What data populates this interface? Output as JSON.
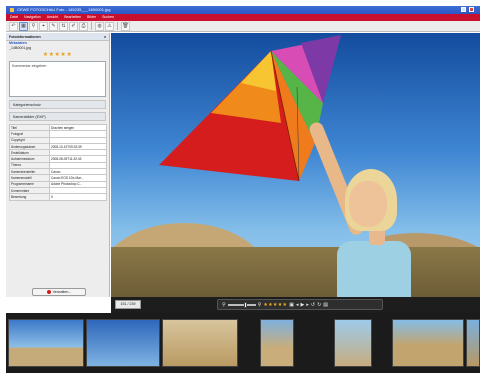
{
  "window": {
    "title": "CEWE FOTOSCHAU Foto - 145235___14B0001.jpg",
    "close_glyph": "×"
  },
  "menu": [
    "Datei",
    "Navigation",
    "Ansicht",
    "Bearbeiten",
    "Bilder",
    "Suchen"
  ],
  "toolbar": {
    "icons": [
      "back-icon",
      "grid-icon",
      "zoom-icon",
      "crop-icon",
      "tools-icon",
      "sort-icon",
      "pen-icon",
      "print-icon",
      "globe-icon",
      "warning-icon",
      "trash-icon"
    ],
    "glyphs": [
      "↶",
      "▦",
      "⚲",
      "⌖",
      "✎",
      "⇅",
      "✐",
      "⎙",
      "◍",
      "⚠",
      "🗑"
    ],
    "active_index": 1
  },
  "sidebar": {
    "header": "Fotoinformationen",
    "close": "x",
    "meta_label": "Metadaten",
    "filename": "_14B0001.jpg",
    "stars": "★★★★★",
    "comment_placeholder": "Kommentar eingeben",
    "sections": {
      "labels": "Kategorienschutz",
      "exif": "Kamerabilder (EXIF)"
    },
    "exif": [
      {
        "k": "Titel",
        "v": "Drachen steigen"
      },
      {
        "k": "Fotograf",
        "v": ""
      },
      {
        "k": "Copyright",
        "v": ""
      },
      {
        "k": "Änderungsdatum",
        "v": "2008-10-19T09:33:39"
      },
      {
        "k": "Erstelldatum",
        "v": ""
      },
      {
        "k": "Aufnahmedatum",
        "v": "2008-08-09T11:32:43"
      },
      {
        "k": "Thema",
        "v": ""
      },
      {
        "k": "Kamerahersteller",
        "v": "Canon"
      },
      {
        "k": "Kameramodell",
        "v": "Canon EOS 1Ds Mar..."
      },
      {
        "k": "Programmname",
        "v": "Adobe Photoshop C..."
      },
      {
        "k": "Kommentare",
        "v": ""
      },
      {
        "k": "Bewertung",
        "v": "5"
      }
    ],
    "button": "Verwalten..."
  },
  "viewer": {
    "page": "151 / 239",
    "stars": "★★★★★"
  },
  "colors": {
    "menubar": "#c8102e",
    "titlebar": "#2a55c2",
    "star": "#f2b01e"
  },
  "filmstrip": {
    "count": 7
  }
}
